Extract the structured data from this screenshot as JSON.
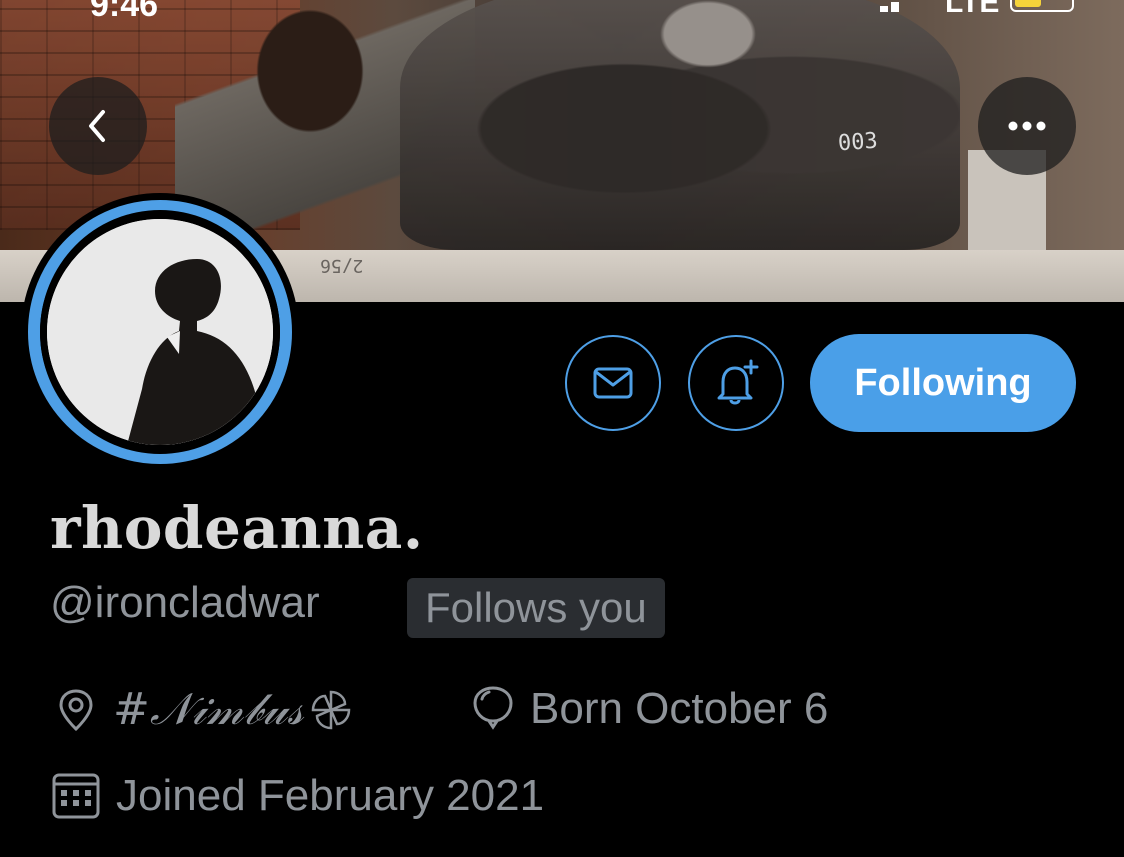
{
  "status_bar": {
    "time": "9:46",
    "network": "LTE"
  },
  "profile": {
    "display_name": "rhodeanna.",
    "handle": "@ironcladwar",
    "follows_you_badge": "Follows you",
    "location": "#𝒩𝒾𝓂𝒷𝓊𝓈",
    "birthday": "Born October 6",
    "joined": "Joined February 2021"
  },
  "banner": {
    "robot_number": "003",
    "floor_number": "2/56"
  },
  "actions": {
    "following_label": "Following"
  },
  "colors": {
    "accent": "#4e9fe6",
    "background": "#000000",
    "muted_text": "#8f949a"
  },
  "icons": [
    "back-chevron-icon",
    "more-dots-icon",
    "mail-icon",
    "bell-plus-icon",
    "location-pin-icon",
    "balloon-icon",
    "calendar-icon",
    "pinwheel-icon"
  ]
}
